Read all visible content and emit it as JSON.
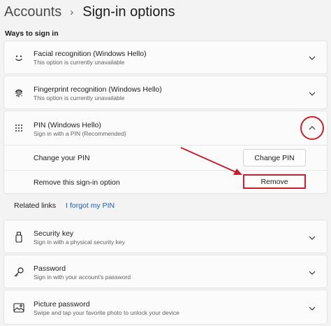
{
  "breadcrumb": {
    "parent": "Accounts",
    "separator": "›",
    "current": "Sign-in options"
  },
  "section_title": "Ways to sign in",
  "options": {
    "facial": {
      "title": "Facial recognition (Windows Hello)",
      "subtitle": "This option is currently unavailable",
      "icon": "smile-icon",
      "expanded": false
    },
    "fingerprint": {
      "title": "Fingerprint recognition (Windows Hello)",
      "subtitle": "This option is currently unavailable",
      "icon": "fingerprint-icon",
      "expanded": false
    },
    "pin": {
      "title": "PIN (Windows Hello)",
      "subtitle": "Sign in with a PIN (Recommended)",
      "icon": "keypad-icon",
      "expanded": true,
      "change_label": "Change your PIN",
      "change_button": "Change PIN",
      "remove_label": "Remove this sign-in option",
      "remove_button": "Remove"
    },
    "security_key": {
      "title": "Security key",
      "subtitle": "Sign in with a physical security key",
      "icon": "usb-key-icon",
      "expanded": false
    },
    "password": {
      "title": "Password",
      "subtitle": "Sign in with your account's password",
      "icon": "key-icon",
      "expanded": false
    },
    "picture_password": {
      "title": "Picture password",
      "subtitle": "Swipe and tap your favorite photo to unlock your device",
      "icon": "picture-icon",
      "expanded": false
    }
  },
  "related": {
    "label": "Related links",
    "link": "I forgot my PIN"
  },
  "colors": {
    "annotation_red": "#c8202a",
    "link_blue": "#1a5fb4",
    "background": "#f3f3f3",
    "card": "#fbfbfb"
  }
}
